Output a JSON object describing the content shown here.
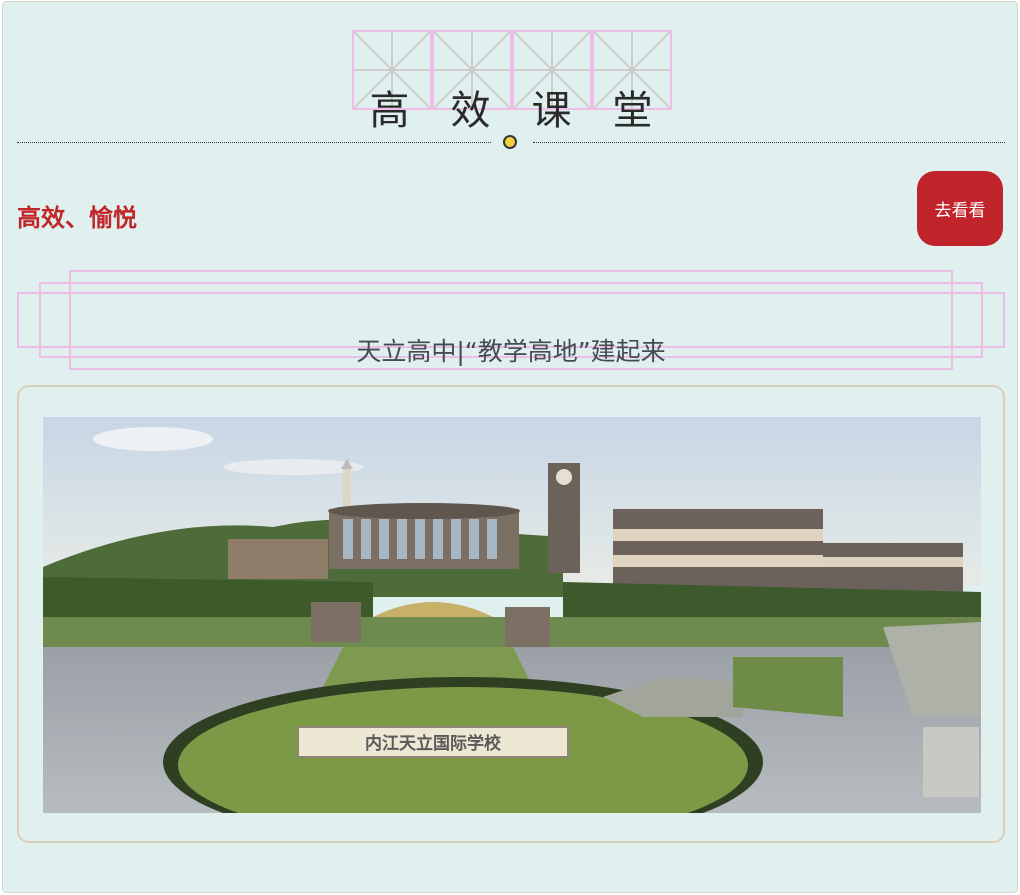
{
  "section": {
    "title_chars": [
      "高",
      "效",
      "课",
      "堂"
    ],
    "subtitle": "高效、愉悦",
    "go_button_label": "去看看",
    "banner_text": "天立高中|“教学高地”建起来"
  },
  "photo": {
    "sign_text": "内江天立国际学校"
  },
  "colors": {
    "background": "#dff0ef",
    "accent_red": "#c1232a",
    "grid_pink": "#ecbde6",
    "dot_yellow": "#f3d13a",
    "card_border": "#dccfba"
  }
}
